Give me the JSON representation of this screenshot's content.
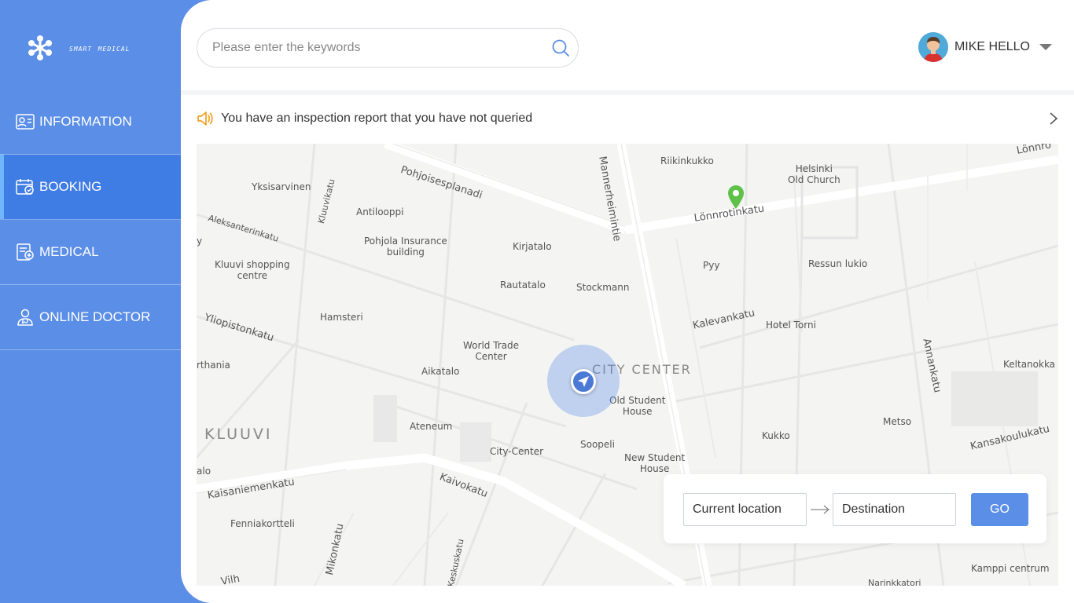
{
  "brand": {
    "name": "smart medical"
  },
  "sidebar": {
    "items": [
      {
        "label": "INFORMATION",
        "icon": "id-card-icon",
        "active": false
      },
      {
        "label": "BOOKING",
        "icon": "calendar-check-icon",
        "active": true
      },
      {
        "label": "MEDICAL",
        "icon": "medical-record-icon",
        "active": false
      },
      {
        "label": "ONLINE DOCTOR",
        "icon": "doctor-icon",
        "active": false
      }
    ]
  },
  "header": {
    "search": {
      "placeholder": "Please enter the keywords",
      "value": ""
    },
    "user": {
      "name": "MIKE HELLO"
    }
  },
  "notice": {
    "text": "You have an inspection report that you have not queried"
  },
  "map": {
    "district_labels": [
      "KLUUVI",
      "CITY CENTER"
    ],
    "street_labels": [
      "Pohjoisesplanadi",
      "Mannerheimintie",
      "Lönnrotinkatu",
      "Aleksanterinkatu",
      "Kluuvikatu",
      "Yliopistonkatu",
      "Kalevankatu",
      "Annankatu",
      "Kaisaniemenkatu",
      "Kaivokatu",
      "Kansakoulukatu",
      "Mikonkatu",
      "Keskuskatu",
      "Lönnro",
      "Vilh",
      "Narinkkatori"
    ],
    "place_labels": [
      "Riikinkukko",
      "Helsinki\nOld Church",
      "Yksisarvinen",
      "Antilooppi",
      "Pohjola Insurance\nbuilding",
      "Kirjatalo",
      "Kluuvi shopping\ncentre",
      "Rautatalo",
      "Stockmann",
      "Pyy",
      "Ressun lukio",
      "Hamsteri",
      "Hotel Torni",
      "World Trade\nCenter",
      "Aikatalo",
      "Old Student\nHouse",
      "Keltanokka",
      "Ateneum",
      "City-Center",
      "Soopeli",
      "Kukko",
      "Metso",
      "New Student\nHouse",
      "Fenniakortteli",
      "Kamppi centrum",
      "rthania",
      "alo",
      "y"
    ],
    "route": {
      "from_value": "Current location",
      "to_value": "Destination",
      "go_label": "GO"
    }
  },
  "colors": {
    "sidebar": "#5b8ee6",
    "active": "#3f7ce4",
    "accent": "#5b8ee6",
    "pin": "#5dc14a",
    "speaker": "#f0a020"
  }
}
